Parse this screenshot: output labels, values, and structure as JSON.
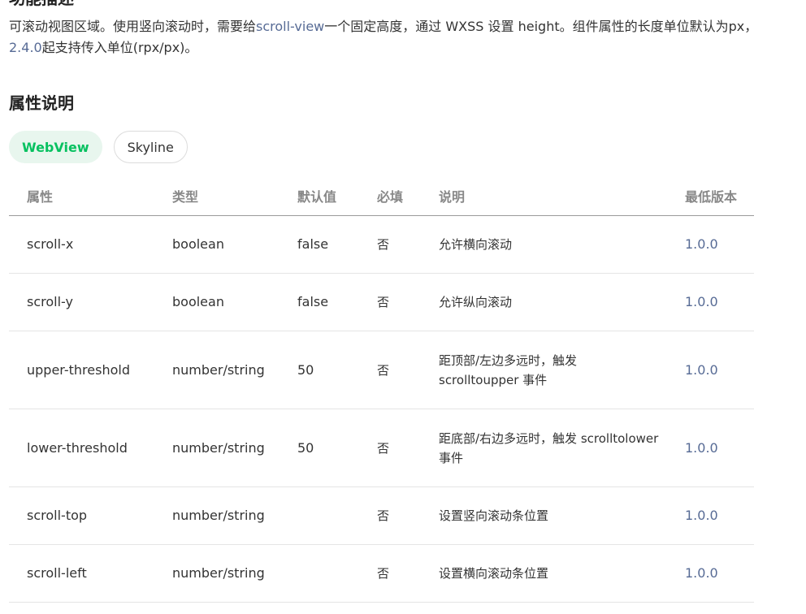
{
  "intro": {
    "part1": "可滚动视图区域。使用竖向滚动时，需要给",
    "link1": "scroll-view",
    "part2": "一个固定高度，通过 WXSS 设置 height。组件属性的长度单位默认为px，",
    "link2": "2.4.0",
    "part3": "起支持传入单位(rpx/px)。"
  },
  "heading_cut": "功能描述",
  "section_title": "属性说明",
  "tabs": [
    {
      "label": "WebView",
      "active": true
    },
    {
      "label": "Skyline",
      "active": false
    }
  ],
  "table": {
    "headers": [
      "属性",
      "类型",
      "默认值",
      "必填",
      "说明",
      "最低版本"
    ],
    "rows": [
      [
        "scroll-x",
        "boolean",
        "false",
        "否",
        "允许横向滚动",
        "1.0.0"
      ],
      [
        "scroll-y",
        "boolean",
        "false",
        "否",
        "允许纵向滚动",
        "1.0.0"
      ],
      [
        "upper-threshold",
        "number/string",
        "50",
        "否",
        "距顶部/左边多远时，触发 scrolltoupper 事件",
        "1.0.0"
      ],
      [
        "lower-threshold",
        "number/string",
        "50",
        "否",
        "距底部/右边多远时，触发 scrolltolower 事件",
        "1.0.0"
      ],
      [
        "scroll-top",
        "number/string",
        "",
        "否",
        "设置竖向滚动条位置",
        "1.0.0"
      ],
      [
        "scroll-left",
        "number/string",
        "",
        "否",
        "设置横向滚动条位置",
        "1.0.0"
      ]
    ]
  },
  "colors": {
    "accent": "#07c160",
    "accent_bg": "#e8f6ee",
    "link": "#576b95",
    "header_text": "#888888"
  }
}
